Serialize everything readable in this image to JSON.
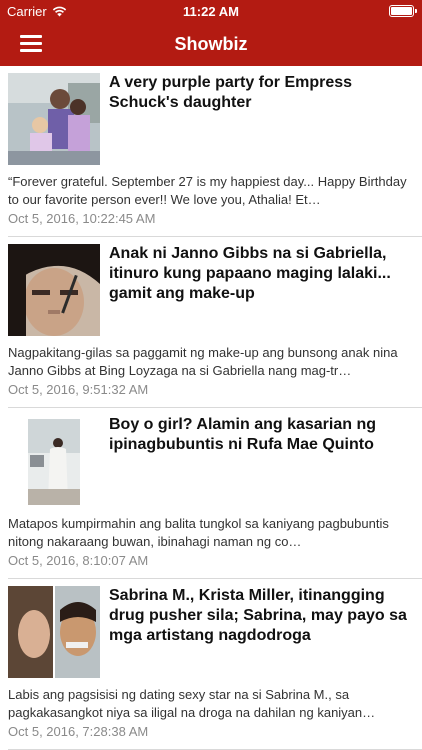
{
  "statusbar": {
    "carrier": "Carrier",
    "time": "11:22 AM"
  },
  "navbar": {
    "title": "Showbiz",
    "menu_icon": "hamburger-menu-icon"
  },
  "articles": [
    {
      "headline": "A very purple party for Empress Schuck's daughter",
      "snippet": "“Forever grateful. September 27 is my happiest day... Happy Birthday to our favorite person ever!! We love you, Athalia! Et…",
      "date": "Oct 5, 2016, 10:22:45 AM"
    },
    {
      "headline": "Anak ni Janno Gibbs na si Gabriella, itinuro kung papaano maging lalaki... gamit ang make-up",
      "snippet": "Nagpakitang-gilas sa paggamit ng make-up ang bunsong anak nina Janno Gibbs at Bing Loyzaga na si Gabriella nang mag-tr…",
      "date": "Oct 5, 2016, 9:51:32 AM"
    },
    {
      "headline": "Boy o girl? Alamin ang kasarian ng ipinagbubuntis ni Rufa Mae Quinto",
      "snippet": "Matapos kumpirmahin ang balita tungkol sa kaniyang pagbubuntis nitong nakaraang buwan, ibinahagi naman ng co…",
      "date": "Oct 5, 2016, 8:10:07 AM"
    },
    {
      "headline": "Sabrina M.,  Krista Miller, itinangging drug pusher sila; Sabrina, may payo sa mga artistang nagdodroga",
      "snippet": "Labis ang pagsisisi ng dating sexy star na si Sabrina M., sa pagkakasangkot niya sa iligal na droga na dahilan ng kaniyan…",
      "date": "Oct 5, 2016, 7:28:38 AM"
    }
  ]
}
